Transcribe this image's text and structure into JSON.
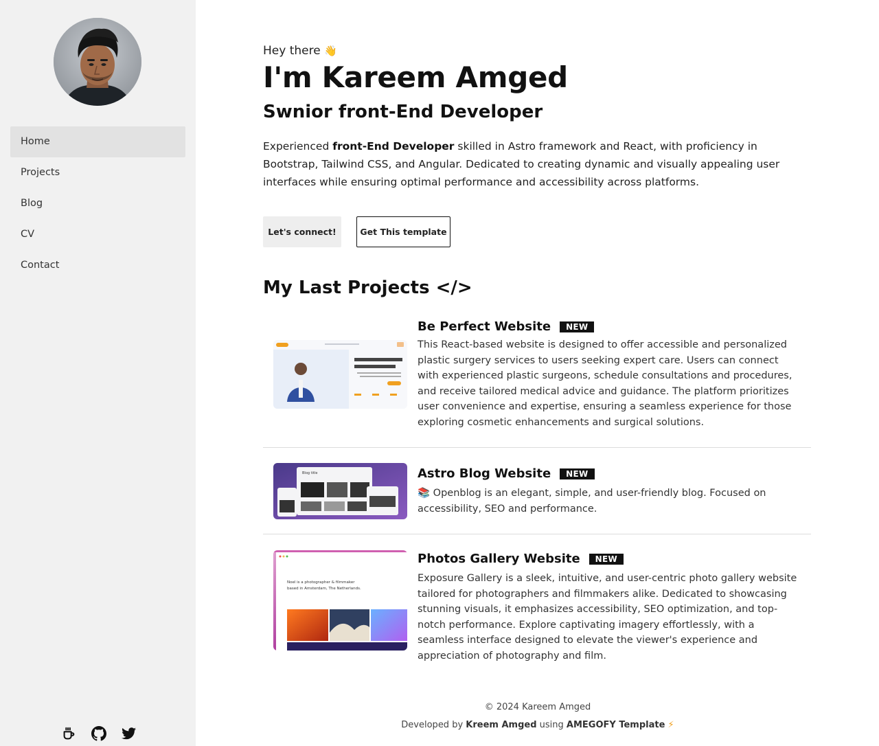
{
  "sidebar": {
    "nav": [
      {
        "label": "Home",
        "active": true
      },
      {
        "label": "Projects",
        "active": false
      },
      {
        "label": "Blog",
        "active": false
      },
      {
        "label": "CV",
        "active": false
      },
      {
        "label": "Contact",
        "active": false
      }
    ],
    "socials": [
      "coffee-icon",
      "github-icon",
      "twitter-icon"
    ]
  },
  "hero": {
    "greeting": "Hey there",
    "greeting_emoji": "👋",
    "name": "I'm Kareem Amged",
    "role": "Swnior front-End Developer",
    "intro_before": "Experienced ",
    "intro_bold": "front-End Developer",
    "intro_after": " skilled in Astro framework and React, with proficiency in Bootstrap, Tailwind CSS, and Angular. Dedicated to creating dynamic and visually appealing user interfaces while ensuring optimal performance and accessibility across platforms.",
    "primary_button": "Let's connect!",
    "secondary_button": "Get This template"
  },
  "projects_section": {
    "title": "My Last Projects </>",
    "items": [
      {
        "title": "Be Perfect Website",
        "badge": "NEW",
        "description": "This React-based website is designed to offer accessible and personalized plastic surgery services to users seeking expert care. Users can connect with experienced plastic surgeons, schedule consultations and procedures, and receive tailored medical advice and guidance. The platform prioritizes user convenience and expertise, ensuring a seamless experience for those exploring cosmetic enhancements and surgical solutions."
      },
      {
        "title": "Astro Blog Website",
        "badge": "NEW",
        "description": "📚 Openblog is an elegant, simple, and user-friendly blog. Focused on accessibility, SEO and performance."
      },
      {
        "title": "Photos Gallery Website",
        "badge": "NEW",
        "description": "Exposure Gallery is a sleek, intuitive, and user-centric photo gallery website tailored for photographers and filmmakers alike. Dedicated to showcasing stunning visuals, it emphasizes accessibility, SEO optimization, and top-notch performance. Explore captivating imagery effortlessly, with a seamless interface designed to elevate the viewer's experience and appreciation of photography and film."
      }
    ]
  },
  "thumbs": {
    "gallery_caption_1": "Noel is a photographer & filmmaker",
    "gallery_caption_2": "based in Amsterdam, The Netherlands.",
    "blog_logo": "Blog title"
  },
  "footer": {
    "copyright": "© 2024 Kareem Amged",
    "dev_prefix": "Developed by ",
    "dev_name": "Kreem Amged",
    "dev_mid": " using ",
    "dev_template": "AMEGOFY Template",
    "dev_emoji": "⚡"
  }
}
